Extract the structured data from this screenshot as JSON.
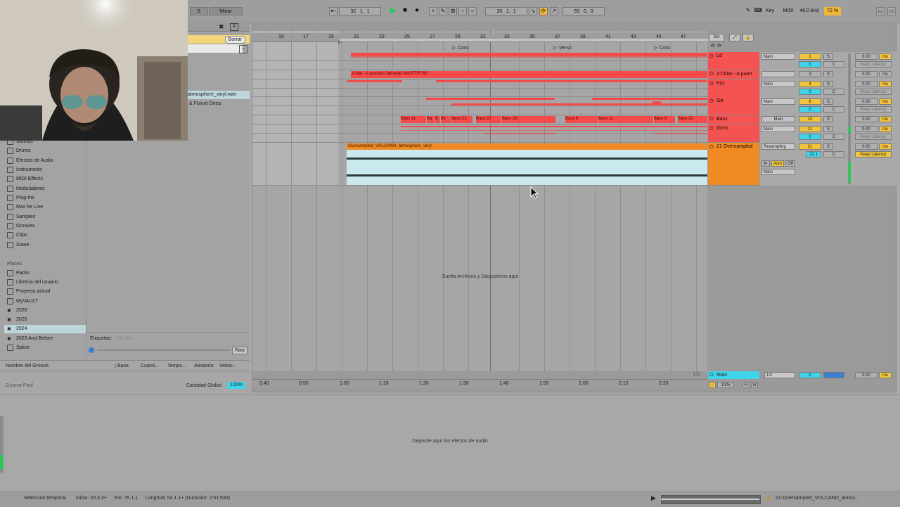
{
  "topbar": {
    "key_value": "8",
    "scale": "Minor",
    "bars": "32",
    "beats": "1",
    "sixteenths": "1",
    "loop_start_bar": "20",
    "loop_start_beat": "1",
    "loop_start_six": "1",
    "loop_len_bar": "55",
    "loop_len_beat": "0",
    "loop_len_six": "0",
    "key_label": "Key",
    "midi_label": "MIDI",
    "sample_rate": "48.0 kHz",
    "cpu": "72 %"
  },
  "browser": {
    "clear_label": "Borrar",
    "files": [
      "atmosphere_vinyl.wav",
      "& Future Deep"
    ],
    "categories": [
      {
        "label": "Sounds",
        "icon": "sounds-icon"
      },
      {
        "label": "Drums",
        "icon": "drums-icon"
      },
      {
        "label": "Efectos de Audio",
        "icon": "audio-effects-icon"
      },
      {
        "label": "Instruments",
        "icon": "instruments-icon"
      },
      {
        "label": "MIDI Effects",
        "icon": "midi-effects-icon"
      },
      {
        "label": "Moduladores",
        "icon": "modulators-icon"
      },
      {
        "label": "Plug-Ins",
        "icon": "plugins-icon"
      },
      {
        "label": "Max for Live",
        "icon": "max-icon"
      },
      {
        "label": "Samples",
        "icon": "samples-icon"
      },
      {
        "label": "Grooves",
        "icon": "grooves-icon"
      },
      {
        "label": "Clips",
        "icon": "clips-icon"
      },
      {
        "label": "Snare",
        "icon": "folder-icon"
      }
    ],
    "places_heading": "Places",
    "places": [
      {
        "label": "Packs",
        "icon": "packs-icon"
      },
      {
        "label": "Librería del usuario",
        "icon": "user-library-icon"
      },
      {
        "label": "Proyecto actual",
        "icon": "project-icon"
      },
      {
        "label": "MyVAULT",
        "icon": "folder-icon"
      },
      {
        "label": "2026",
        "icon": "star-icon"
      },
      {
        "label": "2025",
        "icon": "star-icon"
      },
      {
        "label": "2024",
        "icon": "star-icon"
      },
      {
        "label": "2023 And Before",
        "icon": "star-icon"
      },
      {
        "label": "Splice",
        "icon": "splice-icon"
      }
    ],
    "tags_label": "Etiquetas:",
    "tags_placeholder": "Añadir...",
    "raw_label": "Raw"
  },
  "groove": {
    "columns": [
      "Nombre del Groove",
      "Base",
      "Cuanti...",
      "Tempo...",
      "Aleatorio",
      "Veloci..."
    ],
    "pool_label": "Groove Pool",
    "global_label": "Cantidad Global",
    "global_value": "100%"
  },
  "arrangement": {
    "bar_numbers": [
      "15",
      "17",
      "19",
      "21",
      "23",
      "25",
      "27",
      "29",
      "31",
      "33",
      "35",
      "37",
      "39",
      "41",
      "43",
      "45",
      "47"
    ],
    "locators": [
      "Coro",
      "Verso",
      "Coro"
    ],
    "set_label": "Set",
    "drop_hint": "Suelta Archivos y Dispositivos aquí",
    "time_labels": [
      "0:40",
      "0:50",
      "1:00",
      "1:10",
      "1:20",
      "1:30",
      "1:40",
      "1:50",
      "2:00",
      "2:10",
      "2:20"
    ],
    "fraction": "1/1",
    "clips": {
      "chiar": "Chiar - A puertas Cerradas MASTER BV",
      "bass": [
        "Bass 11",
        "Ba",
        "B",
        "Bc",
        "Bass 22",
        "Bass 22",
        "Bass 28",
        "Bass 9",
        "Bass 11",
        "Bass 6",
        "Bass 22"
      ],
      "oversampled": "Oversampled_VOLCANO_atmosphere_vinyl"
    }
  },
  "tracks": [
    {
      "name": "Ld",
      "input": "Main",
      "num": "1",
      "vol": "0.00",
      "unit": "ms",
      "color": "#f55252"
    },
    {
      "name": "3 Chiar - A puert",
      "input": "",
      "num": "3",
      "vol": "0.00",
      "unit": "ms",
      "color": "#f55252"
    },
    {
      "name": "Kys",
      "input": "Main",
      "num": "4",
      "vol": "0.00",
      "unit": "ms",
      "color": "#f55252"
    },
    {
      "name": "Gtr",
      "input": "Main",
      "num": "6",
      "vol": "0.00",
      "unit": "ms",
      "color": "#f55252"
    },
    {
      "name": "Bass",
      "input": "Main",
      "num": "10",
      "vol": "0.00",
      "unit": "ms",
      "color": "#f55252"
    },
    {
      "name": "Drms",
      "input": "Main",
      "num": "11",
      "vol": "0.00",
      "unit": "ms",
      "color": "#f55252"
    },
    {
      "name": "21 Oversampled",
      "input": "Resampling",
      "num": "21",
      "vol": "0.00",
      "unit": "ms",
      "color": "#f08a24"
    }
  ],
  "mixer": {
    "solo": "S",
    "cue": "C",
    "keep_latency": "Keep Latency",
    "zero": "0",
    "in": "In",
    "auto": "Auto",
    "off": "Off",
    "send_val": "22.1"
  },
  "main_track": {
    "name": "Main",
    "routing": "1/2",
    "vol": "0.00",
    "zoom": "100x",
    "h": "H",
    "w": "W"
  },
  "device_hint": "Deposite aquí los efectos de audio",
  "status": {
    "mode": "Selección temporal",
    "start": "Inicio: 20.3.3+",
    "end": "Fin: 75.1.1",
    "length": "Longitud: 54.1.1+ (Duración: 2:51:533)",
    "clip_name": "21-Oversampled_VOLCANO_atmos..."
  }
}
